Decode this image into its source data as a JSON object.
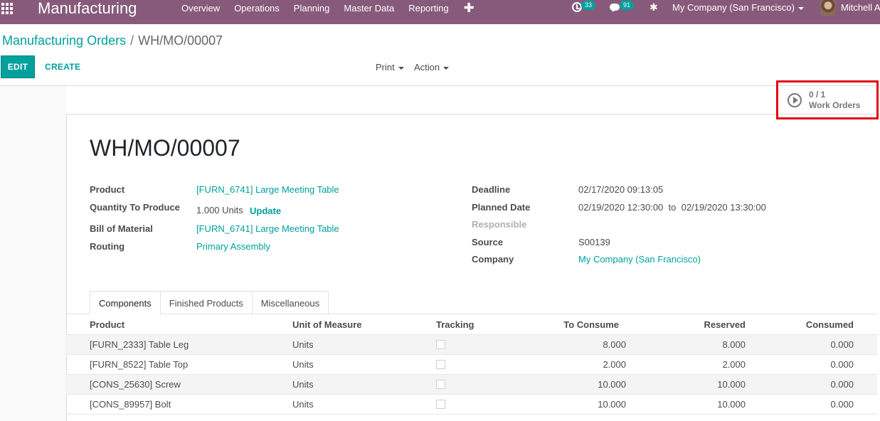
{
  "navbar": {
    "app_name": "Manufacturing",
    "menu": [
      "Overview",
      "Operations",
      "Planning",
      "Master Data",
      "Reporting"
    ],
    "plus": "✚",
    "activity_count": "33",
    "message_count": "91",
    "company": "My Company (San Francisco)",
    "user": "Mitchell A"
  },
  "breadcrumb": {
    "parent": "Manufacturing Orders",
    "separator": "/",
    "current": "WH/MO/00007"
  },
  "toolbar": {
    "edit_label": "EDIT",
    "create_label": "CREATE",
    "print_label": "Print",
    "action_label": "Action"
  },
  "smart_button": {
    "value": "0 / 1",
    "label": "Work Orders"
  },
  "record": {
    "title": "WH/MO/00007",
    "left_fields": {
      "product_label": "Product",
      "product_value": "[FURN_6741] Large Meeting Table",
      "qty_label": "Quantity To Produce",
      "qty_value": "1.000 Units",
      "update_label": "Update",
      "bom_label": "Bill of Material",
      "bom_value": "[FURN_6741] Large Meeting Table",
      "routing_label": "Routing",
      "routing_value": "Primary Assembly"
    },
    "right_fields": {
      "deadline_label": "Deadline",
      "deadline_value": "02/17/2020 09:13:05",
      "planned_label": "Planned Date",
      "planned_start": "02/19/2020 12:30:00",
      "planned_to": "to",
      "planned_end": "02/19/2020 13:30:00",
      "responsible_label": "Responsible",
      "source_label": "Source",
      "source_value": "S00139",
      "company_label": "Company",
      "company_value": "My Company (San Francisco)"
    }
  },
  "tabs": [
    "Components",
    "Finished Products",
    "Miscellaneous"
  ],
  "table": {
    "headers": [
      "Product",
      "Unit of Measure",
      "Tracking",
      "To Consume",
      "Reserved",
      "Consumed"
    ],
    "rows": [
      {
        "product": "[FURN_2333] Table Leg",
        "uom": "Units",
        "to_consume": "8.000",
        "reserved": "8.000",
        "consumed": "0.000"
      },
      {
        "product": "[FURN_8522] Table Top",
        "uom": "Units",
        "to_consume": "2.000",
        "reserved": "2.000",
        "consumed": "0.000"
      },
      {
        "product": "[CONS_25630] Screw",
        "uom": "Units",
        "to_consume": "10.000",
        "reserved": "10.000",
        "consumed": "0.000"
      },
      {
        "product": "[CONS_89957] Bolt",
        "uom": "Units",
        "to_consume": "10.000",
        "reserved": "10.000",
        "consumed": "0.000"
      }
    ]
  },
  "colors": {
    "navbar": "#875a7b",
    "accent": "#00a09d",
    "highlight_box": "#e30613"
  }
}
